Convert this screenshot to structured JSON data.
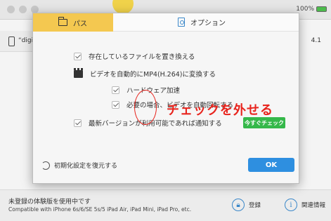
{
  "status_bar": {
    "battery_percent": "100%"
  },
  "device_list": {
    "device_name": "“digi",
    "version": "4.1"
  },
  "footer": {
    "trial_notice": "未登録の体験版を使用中です",
    "compatibility": "Compatible with iPhone 6s/6/SE 5s/5 iPad Air, iPad Mini, iPad Pro, etc.",
    "register_label": "登録",
    "about_label": "関連情報"
  },
  "dialog": {
    "tabs": [
      {
        "label": "パス",
        "icon": "folder-icon"
      },
      {
        "label": "オプション",
        "icon": "document-icon"
      }
    ],
    "options": {
      "replace_existing": "存在しているファイルを置き換える",
      "convert_mp4": "ビデオを自動的にMP4(H.264)に変換する",
      "hardware_accel": "ハードウェア加速",
      "rotate_video": "必要の場合、ビデオを自動回転する",
      "notify_update": "最新バージョンが利用可能であれば通知する"
    },
    "check_now_label": "今すぐチェック",
    "restore_defaults_label": "初期化設定を復元する",
    "ok_label": "OK"
  },
  "annotation": {
    "text": "チェックを外せる"
  },
  "colors": {
    "tab_active_bg": "#f4c850",
    "accent_blue": "#2e8fe0",
    "check_now_green": "#35b84a",
    "annotation_red": "#e8241d"
  }
}
